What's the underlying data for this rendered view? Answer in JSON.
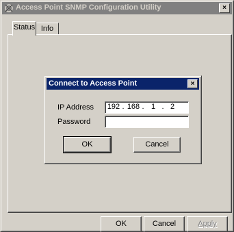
{
  "window": {
    "title": "Access Point SNMP Configuration Utility",
    "close_glyph": "×"
  },
  "tabs": [
    {
      "label": "Status"
    },
    {
      "label": "Info"
    }
  ],
  "dialog": {
    "title": "Connect to Access Point",
    "close_glyph": "×",
    "ip_label": "IP Address",
    "ip": [
      "192",
      "168",
      "1",
      "2"
    ],
    "ip_sep": ".",
    "password_label": "Password",
    "password_value": "",
    "ok_label": "OK",
    "cancel_label": "Cancel"
  },
  "footer": {
    "ok_label": "OK",
    "cancel_label": "Cancel",
    "apply_label": "Apply"
  }
}
